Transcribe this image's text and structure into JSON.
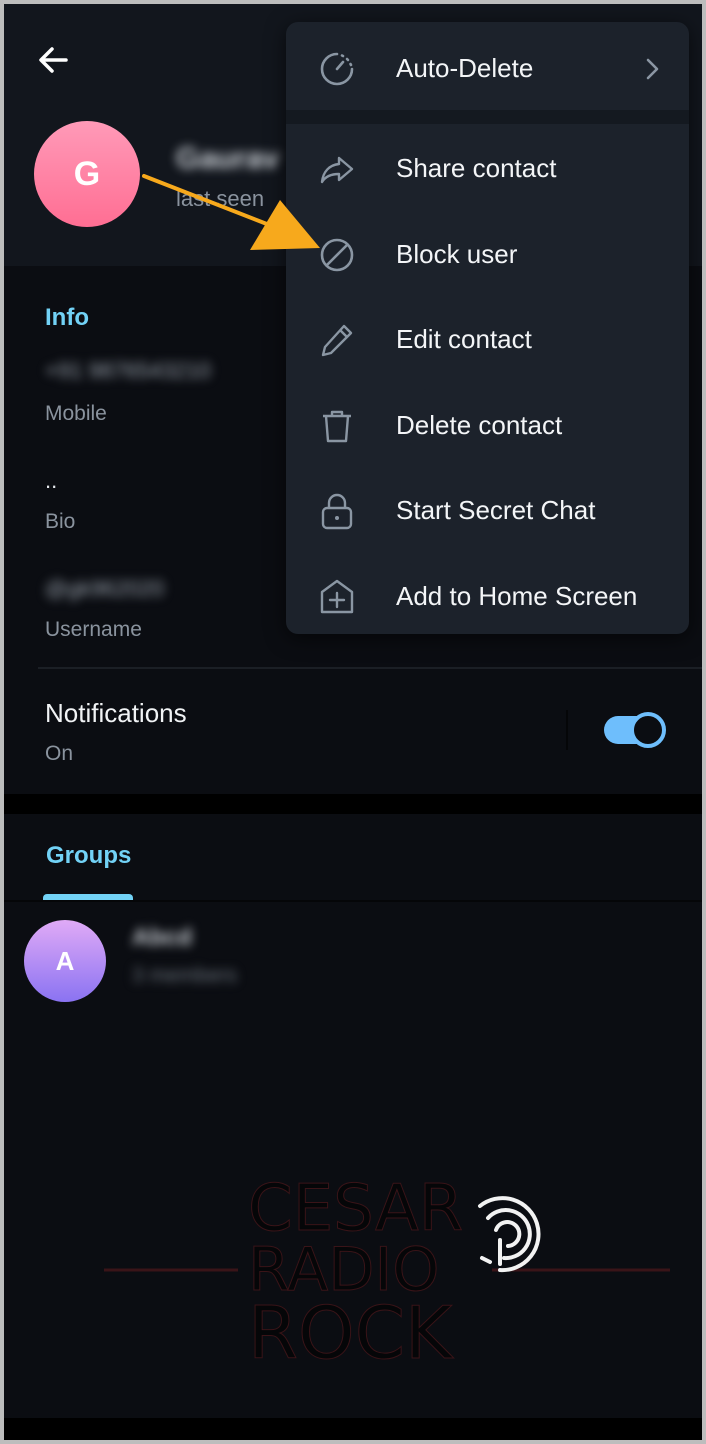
{
  "header": {
    "back_icon": "arrow-left-icon",
    "avatar_letter": "G",
    "name": "Gaurav",
    "status": "last seen"
  },
  "info": {
    "title": "Info",
    "rows": [
      {
        "value": "+91 9876543210",
        "label": "Mobile",
        "blurred": true
      },
      {
        "value": "..",
        "label": "Bio",
        "blurred": false
      },
      {
        "value": "@gk962020",
        "label": "Username",
        "blurred": true
      }
    ]
  },
  "notifications": {
    "title": "Notifications",
    "status": "On",
    "enabled": true,
    "accent": "#6ebefc"
  },
  "groups": {
    "tab_label": "Groups",
    "items": [
      {
        "avatar_letter": "A",
        "name": "Abcd",
        "members": "3 members"
      }
    ]
  },
  "menu": {
    "items": [
      {
        "label": "Auto-Delete",
        "icon": "timer-icon",
        "has_submenu": true
      },
      {
        "label": "Share contact",
        "icon": "share-icon",
        "has_submenu": false
      },
      {
        "label": "Block user",
        "icon": "block-icon",
        "has_submenu": false
      },
      {
        "label": "Edit contact",
        "icon": "pencil-icon",
        "has_submenu": false
      },
      {
        "label": "Delete contact",
        "icon": "trash-icon",
        "has_submenu": false
      },
      {
        "label": "Start Secret Chat",
        "icon": "lock-icon",
        "has_submenu": false
      },
      {
        "label": "Add to Home Screen",
        "icon": "add-home-icon",
        "has_submenu": false
      }
    ]
  },
  "annotation": {
    "arrow_color": "#f7a91c",
    "points_to": "Block user"
  },
  "watermark": {
    "lines": [
      "CESAR",
      "RADIO",
      "ROCK"
    ]
  },
  "colors": {
    "accent_blue": "#72d2f6",
    "menu_bg": "#1c222b",
    "background": "#0b0d12"
  }
}
